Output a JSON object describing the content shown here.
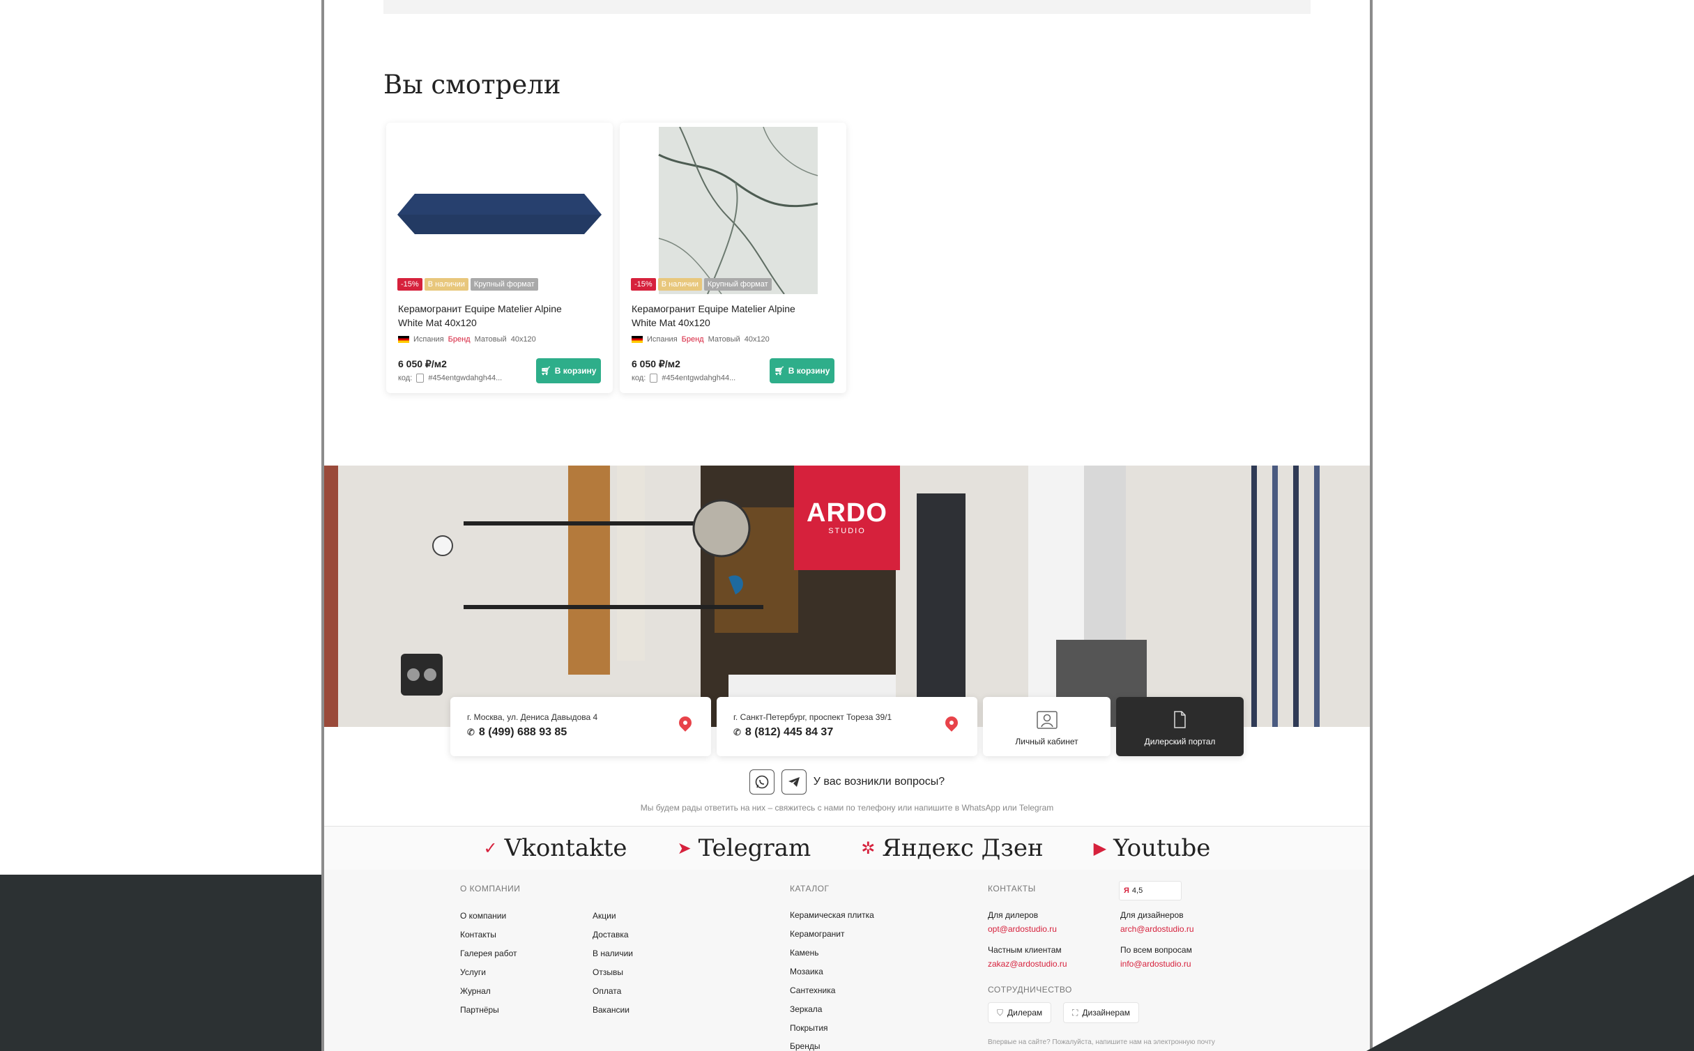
{
  "viewed": {
    "title": "Вы смотрели",
    "cards": [
      {
        "badges": [
          "-15%",
          "В наличии",
          "Крупный формат"
        ],
        "name": "Керамогранит Equipe Matelier Alpine White Mat 40x120",
        "country": "Испания",
        "brand": "Бренд",
        "finish": "Матовый",
        "size": "40х120",
        "price": "6 050 ₽/м2",
        "code_label": "код:",
        "code": "#454entgwdahgh44...",
        "cart": "В корзину"
      },
      {
        "badges": [
          "-15%",
          "В наличии",
          "Крупный формат"
        ],
        "name": "Керамогранит Equipe Matelier Alpine White Mat 40x120",
        "country": "Испания",
        "brand": "Бренд",
        "finish": "Матовый",
        "size": "40х120",
        "price": "6 050 ₽/м2",
        "code_label": "код:",
        "code": "#454entgwdahgh44...",
        "cart": "В корзину"
      }
    ]
  },
  "logo": {
    "main": "ARDO",
    "sub": "STUDIO"
  },
  "contacts": {
    "moscow": {
      "address": "г. Москва, ул. Дениса Давыдова 4",
      "phone": "8 (499) 688 93 85"
    },
    "spb": {
      "address": "г. Санкт-Петербург, проспект Тореза 39/1",
      "phone": "8 (812) 445 84 37"
    },
    "cabinet": "Личный кабинет",
    "dealer_portal": "Дилерский портал"
  },
  "questions": {
    "title": "У вас возникли вопросы?",
    "subtitle": "Мы будем рады ответить на них – свяжитесь с нами по телефону или напишите в WhatsApp или Telegram"
  },
  "social": [
    {
      "icon": "vk-icon",
      "label": "Vkontakte"
    },
    {
      "icon": "telegram-icon",
      "label": "Telegram"
    },
    {
      "icon": "dzen-icon",
      "label": "Яндекс Дзен"
    },
    {
      "icon": "youtube-icon",
      "label": "Youtube"
    }
  ],
  "footer": {
    "company_title": "О компании",
    "company_col1": [
      "О компании",
      "Контакты",
      "Галерея работ",
      "Услуги",
      "Журнал",
      "Партнёры"
    ],
    "company_col2": [
      "Акции",
      "Доставка",
      "В наличии",
      "Отзывы",
      "Оплата",
      "Вакансии"
    ],
    "catalog_title": "Каталог",
    "catalog": [
      "Керамическая плитка",
      "Керамогранит",
      "Камень",
      "Мозаика",
      "Сантехника",
      "Зеркала",
      "Покрытия",
      "Бренды"
    ],
    "contacts_title": "Контакты",
    "rating": "4,5",
    "dealers_label": "Для дилеров",
    "dealers_mail": "opt@ardostudio.ru",
    "designers_label": "Для дизайнеров",
    "designers_mail": "arch@ardostudio.ru",
    "private_label": "Частным клиентам",
    "private_mail": "zakaz@ardostudio.ru",
    "all_label": "По всем вопросам",
    "all_mail": "info@ardostudio.ru",
    "coop_title": "Сотрудничество",
    "coop_dealers": "Дилерам",
    "coop_designers": "Дизайнерам",
    "note": "Впервые на сайте? Пожалуйста, напишите нам на электронную почту"
  },
  "colors": {
    "accent": "#d6213c",
    "cart": "#2eae8a",
    "dark": "#2c3133"
  }
}
